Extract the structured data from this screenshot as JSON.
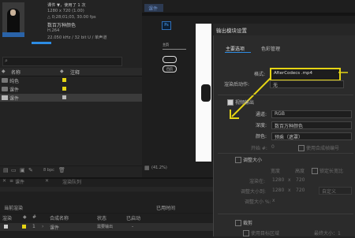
{
  "project": {
    "title": "课件",
    "used": "▼，使用了 1 次",
    "size": "1280 x 720 (1.00)",
    "duration": "△ 0;28;01;03, 30.00 fps",
    "color": "数百万种颜色",
    "codec": "H.264",
    "audio": "22.050 kHz / 32 bit U / 单声道",
    "search_placeholder": "",
    "col_name": "名称",
    "col_comment": "注释",
    "items": [
      {
        "name": "纯色",
        "icon": "folder-icon",
        "color": "#e5d414"
      },
      {
        "name": "课件",
        "icon": "folder-icon",
        "color": "#e5d414"
      },
      {
        "name": "课件",
        "icon": "composition-icon",
        "color": "#b9b9b9"
      }
    ],
    "bpc": "8 bpc"
  },
  "viewer": {
    "tab": "课件",
    "ps_label": "Ps",
    "menu": [
      "主页",
      "",
      ""
    ],
    "pills": [
      "",
      "目页"
    ],
    "zoom": "(41.2%)"
  },
  "timeline": {
    "tab": "课件",
    "render_queue": "渲染队列",
    "current_render": "当前渲染",
    "elapsed": "已用时间",
    "col_render": "渲染",
    "col_num": "#",
    "col_comp": "合成名称",
    "col_status": "状态",
    "col_started": "已启动",
    "row_num": "1",
    "row_comp": "课件",
    "row_status": "需要输出",
    "row_time": "-"
  },
  "dialog": {
    "title": "输出模块设置",
    "tab_main": "主要选项",
    "tab_color": "色彩管理",
    "format_label": "格式:",
    "format_value": "AfterCodecs .mp4",
    "post_render_label": "渲染后动作:",
    "post_render_value": "无",
    "video_output_label": "视频输出",
    "channels_label": "通道:",
    "channels_value": "RGB",
    "depth_label": "深度:",
    "depth_value": "数百万种颜色",
    "color_label": "颜色:",
    "color_value": "预乘（遮罩）",
    "start_label": "开始 #:",
    "start_value": "0",
    "use_comp_frame": "使用合成帧编号",
    "resize_label": "调整大小",
    "width_label": "宽度",
    "height_label": "高度",
    "lock_aspect": "锁定长宽比",
    "render_at_label": "渲染在:",
    "render_w": "1280",
    "render_h": "720",
    "resize_to_label": "调整大小到:",
    "resize_w": "1280",
    "resize_h": "720",
    "custom_label": "自定义",
    "resize_pct_label": "调整大小 %:",
    "crop_label": "裁剪",
    "use_roi": "使用目标区域",
    "final_size": "最终大小：1"
  },
  "colors": {
    "highlight": "#e5d414",
    "selection_blue": "#2d8ce3"
  }
}
